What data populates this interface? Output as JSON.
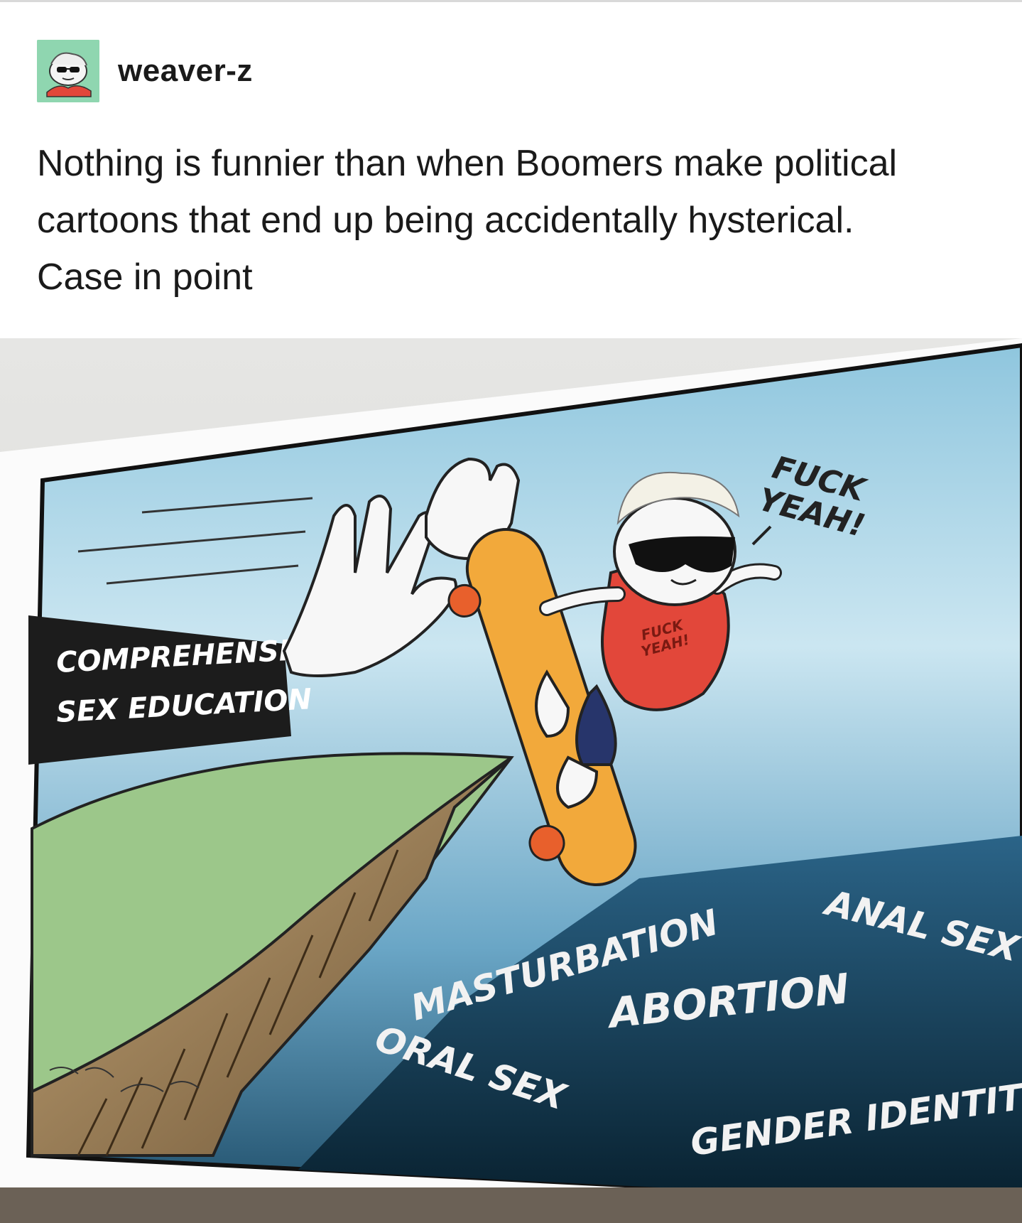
{
  "post": {
    "username": "weaver-z",
    "avatar_icon": "avatar-sunglasses-skater-icon",
    "text_lines": [
      "Nothing is funnier than when Boomers make political",
      "cartoons that end up being accidentally hysterical.",
      "Case in point"
    ]
  },
  "cartoon": {
    "sleeve_label_line1": "COMPREHENSIVE",
    "sleeve_label_line2": "SEX EDUCATION",
    "speech": "FUCK YEAH!",
    "speech_line1": "FUCK",
    "speech_line2": "YEAH!",
    "shirt_text_line1": "FUCK",
    "shirt_text_line2": "YEAH!",
    "topics": {
      "masturbation": "MASTURBATION",
      "anal_sex": "ANAL SEX",
      "abortion": "ABORTION",
      "oral_sex": "ORAL SEX",
      "gender_identities": "GENDER IDENTITIES"
    },
    "colors": {
      "sky": "#b9dcec",
      "sky_dark": "#2f6f93",
      "abyss": "#0e2a3a",
      "grass": "#9cc78a",
      "sleeve": "#1c1c1c",
      "skateboard": "#f2a93b",
      "wheels": "#e8602c",
      "shirt": "#e2473a",
      "shorts": "#27356b"
    }
  }
}
